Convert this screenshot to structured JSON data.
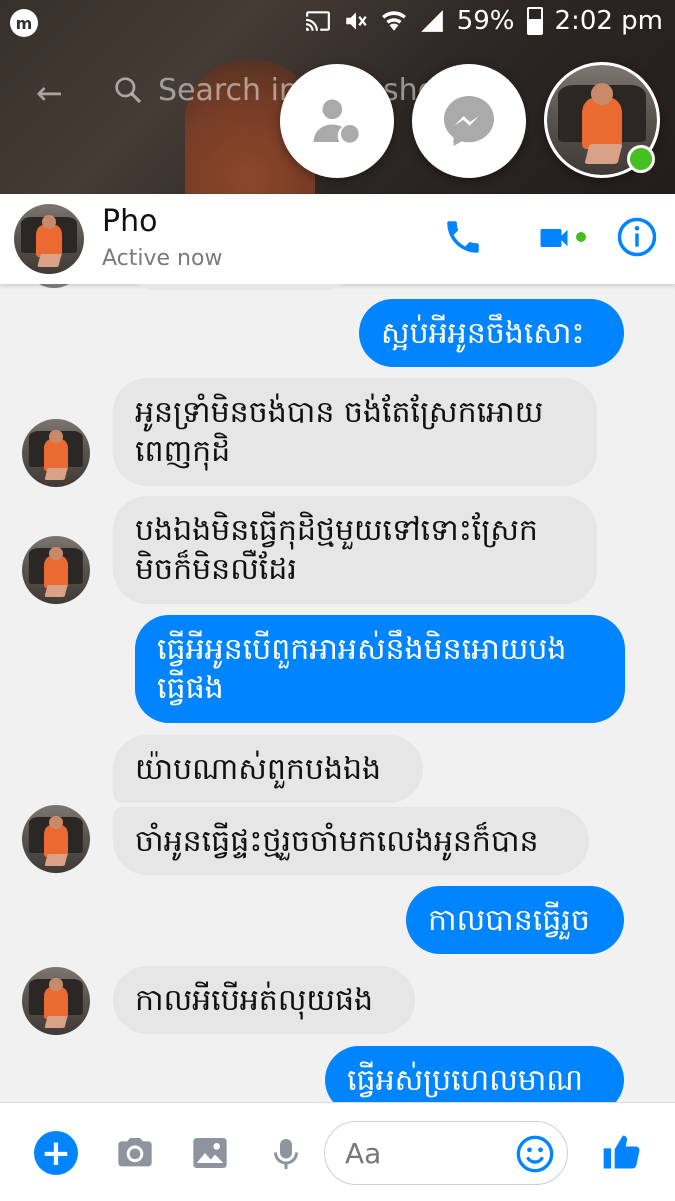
{
  "status_bar": {
    "app_logo": "m",
    "battery": "59%",
    "time": "2:02 pm",
    "icons": [
      "cast-icon",
      "mute-icon",
      "wifi-icon",
      "signal-icon",
      "battery-icon"
    ]
  },
  "search": {
    "placeholder": "Search in Snapshot"
  },
  "chat_heads": {
    "icons": [
      "people-icon",
      "messenger-icon",
      "profile-avatar"
    ],
    "online": true
  },
  "conversation": {
    "name": "Pho",
    "status": "Active now",
    "actions": [
      "phone-icon",
      "video-icon",
      "info-icon"
    ],
    "accent_color": "#0084ff",
    "online_color": "#44c023"
  },
  "messages": [
    {
      "direction": "out",
      "text": "ស្អប់អីអូនចឹងសោះ"
    },
    {
      "direction": "in",
      "text": "អូនទ្រាំមិនចង់បាន ចង់តែស្រែកអោយ\nពេញកុដិ"
    },
    {
      "direction": "in",
      "text": "បងឯងមិនធ្វើកុដិថ្មមួយទៅទោះស្រែក\nមិចក៏មិនលឺដែរ"
    },
    {
      "direction": "out",
      "text": "ធ្វើអីអូនបើពួកអាអស់នឹងមិនអោយបង\nធ្វើផង"
    },
    {
      "direction": "in",
      "text": "យ៉ាបណាស់ពួកបងឯង"
    },
    {
      "direction": "in",
      "text": "ចាំអូនធ្វើផ្ទះថ្មរួចចាំមកលេងអូនក៏បាន"
    },
    {
      "direction": "out",
      "text": "កាលបានធ្វើរួច"
    },
    {
      "direction": "in",
      "text": "កាលអីបើអត់លុយផង"
    },
    {
      "direction": "out",
      "text": "ធ្វើអស់ប្រហេលមាណ"
    }
  ],
  "composer": {
    "placeholder": "Aa",
    "icons": [
      "plus-icon",
      "camera-icon",
      "gallery-icon",
      "microphone-icon",
      "emoji-icon",
      "like-icon"
    ]
  }
}
